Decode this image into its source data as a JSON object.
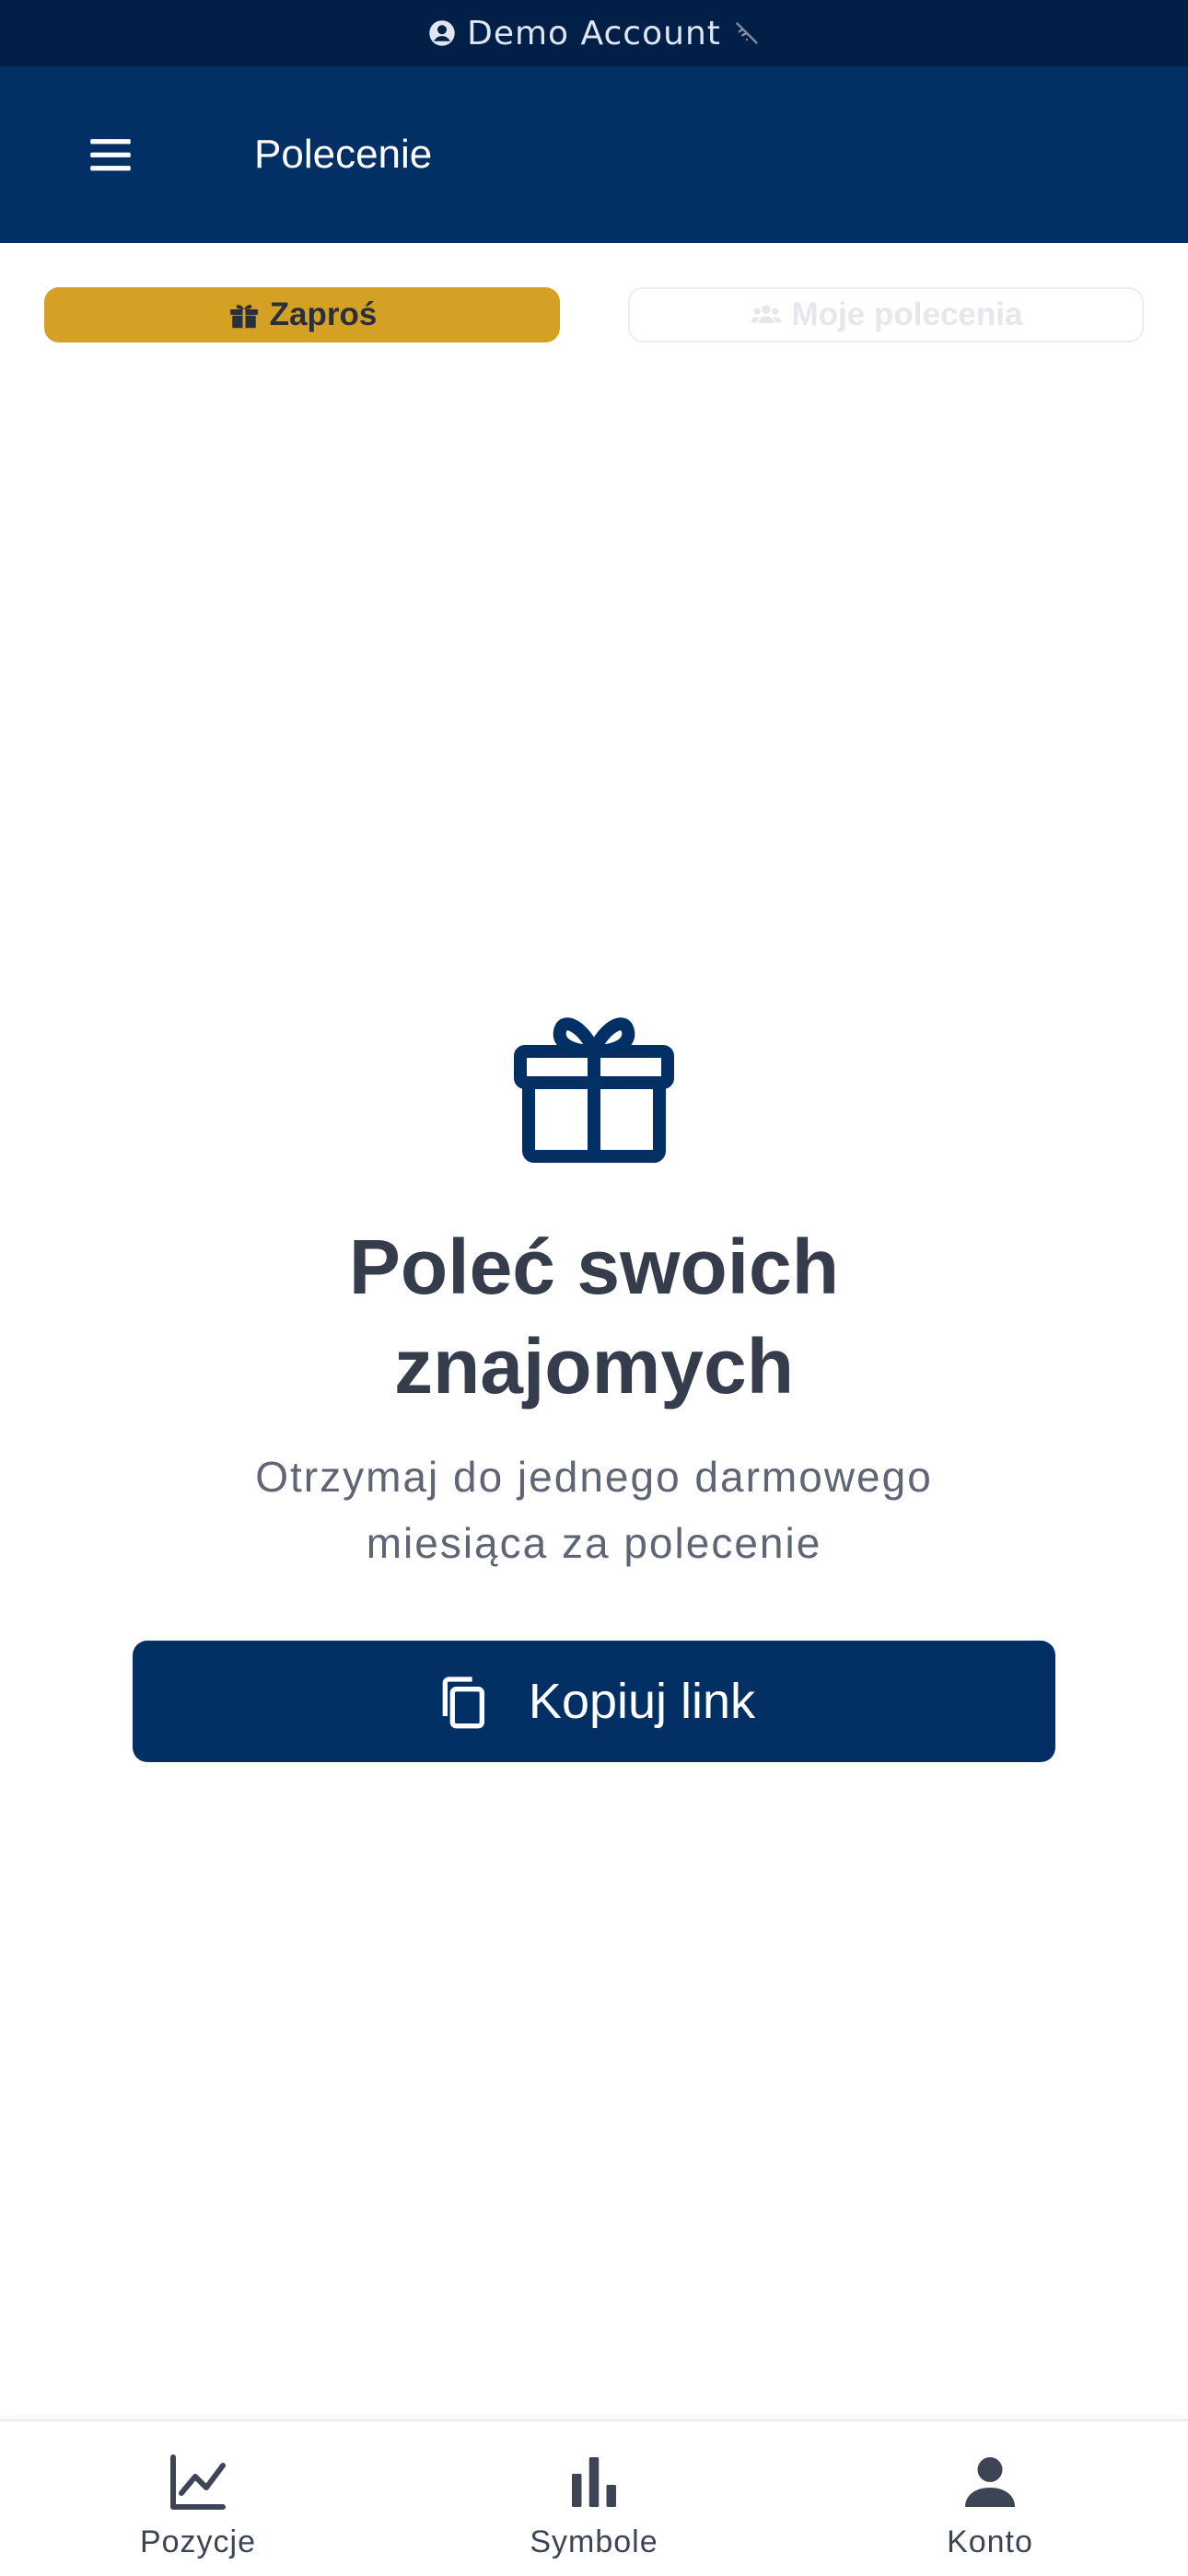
{
  "status_bar": {
    "account_label": "Demo Account",
    "account_icon": "account-circle-icon",
    "connection_icon": "wifi-off-icon"
  },
  "header": {
    "title": "Polecenie",
    "menu_icon": "hamburger-menu-icon",
    "background": "#023064"
  },
  "tabs": [
    {
      "label": "Zaproś",
      "icon": "gift-icon",
      "active": true,
      "color": "#d4a124"
    },
    {
      "label": "Moje polecenia",
      "icon": "group-icon",
      "active": false
    }
  ],
  "main": {
    "icon": "gift-icon",
    "title": "Poleć swoich znajomych",
    "subtitle": "Otrzymaj do jednego darmowego miesiąca za polecenie",
    "button_label": "Kopiuj link",
    "button_icon": "copy-icon"
  },
  "bottom_nav": {
    "items": [
      {
        "label": "Pozycje",
        "icon": "line-chart-icon"
      },
      {
        "label": "Symbole",
        "icon": "bar-chart-icon"
      },
      {
        "label": "Konto",
        "icon": "person-icon"
      }
    ]
  },
  "colors": {
    "accent": "#d4a124",
    "primary": "#023064",
    "status_bar": "#021f47"
  }
}
